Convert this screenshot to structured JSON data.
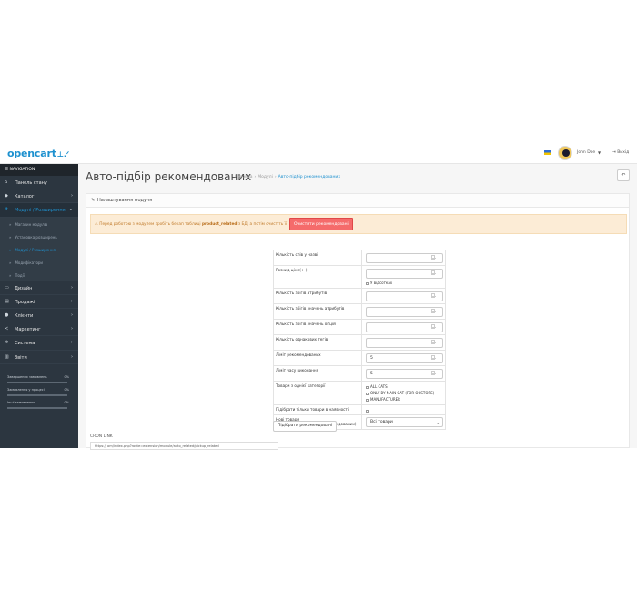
{
  "header": {
    "logo": "opencart",
    "logo_cart": "⊥.ᐟ",
    "user_name": "John Doe",
    "user_caret": "▼",
    "logout": "Вихід"
  },
  "sidebar": {
    "nav_title": "☰ NAVIGATION",
    "items": [
      {
        "label": "Панель стану",
        "icon": "dashboard-icon",
        "glyph": "⌂",
        "chev": ""
      },
      {
        "label": "Каталог",
        "icon": "tag-icon",
        "glyph": "◆",
        "chev": "›"
      },
      {
        "label": "Модулі / Розширення",
        "icon": "puzzle-icon",
        "glyph": "✚",
        "chev": "⌄"
      }
    ],
    "subitems": [
      "Магазин модулів",
      "Установка розширень",
      "Модулі / Розширення",
      "Модифікатори",
      "Події"
    ],
    "items2": [
      {
        "label": "Дизайн",
        "icon": "monitor-icon",
        "glyph": "▭",
        "chev": "›"
      },
      {
        "label": "Продажі",
        "icon": "cart-icon",
        "glyph": "▤",
        "chev": "›"
      },
      {
        "label": "Клієнти",
        "icon": "user-icon",
        "glyph": "●",
        "chev": "›"
      },
      {
        "label": "Маркетинг",
        "icon": "share-icon",
        "glyph": "≺",
        "chev": "›"
      },
      {
        "label": "Система",
        "icon": "cog-icon",
        "glyph": "✲",
        "chev": "›"
      },
      {
        "label": "Звіти",
        "icon": "bar-chart-icon",
        "glyph": "▥",
        "chev": "›"
      }
    ],
    "stats": [
      {
        "label": "Завершених замовлень",
        "value": "0%",
        "fill": 0
      },
      {
        "label": "Замовлення у процесі",
        "value": "0%",
        "fill": 0
      },
      {
        "label": "Інші замовлення",
        "value": "0%",
        "fill": 0
      }
    ]
  },
  "page": {
    "title": "Авто-підбір рекомендованих",
    "crumbs": [
      "Головна",
      "Модулі",
      "Авто-підбір рекомендованих"
    ],
    "crumb_sep": "›",
    "back_glyph": "↶"
  },
  "panel": {
    "title": "Налаштування модуля",
    "pencil": "✎"
  },
  "alert": {
    "text_before": "⚠ Перед роботою з модулем зробіть бекап таблиці ",
    "bold": "product_related",
    "text_after": " з БД, а потім очистіть її",
    "button": "Очистити рекомендовані"
  },
  "form": {
    "rows": [
      {
        "label": "Кількість слів у назві",
        "value": ""
      },
      {
        "label": "Розкид ціни(+-)",
        "value": "",
        "checkbox": "У відсотках"
      },
      {
        "label": "Кількість збігів атрибутів",
        "value": ""
      },
      {
        "label": "Кількість збігів значень атрибутів",
        "value": ""
      },
      {
        "label": "Кількість збігів значень опцій",
        "value": ""
      },
      {
        "label": "Кількість однакових тегів",
        "value": ""
      },
      {
        "label": "Ліміт рекомендованих",
        "value": "5"
      },
      {
        "label": "Ліміт часу виконання",
        "value": "5"
      }
    ],
    "category_label": "Товари з однієї категорії",
    "category_options": [
      "ALL CATS",
      "ONLY BY MAIN CAT (FOR OCSTORE)",
      "MANUFACTURER"
    ],
    "stock_label": "Підібрати тільки товари в наявності",
    "new_label_1": "Нові товари",
    "new_label_2": "(товари, що не мають рекомендованих)",
    "new_select": "Всі товари",
    "select_caret": "⌄",
    "submit": "Підібрати рекомендовані"
  },
  "cron": {
    "label": "CRON LINK",
    "link": "https://           om/index.php?route=extension/module/auto_related/pickup_related"
  }
}
